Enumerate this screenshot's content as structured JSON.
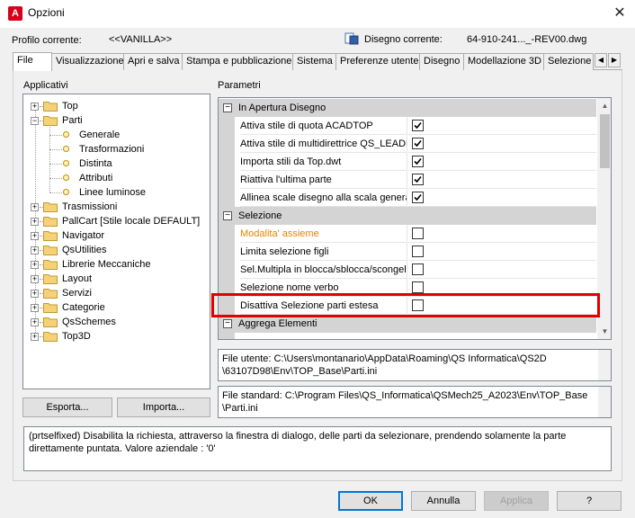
{
  "window": {
    "title": "Opzioni",
    "app_icon_letter": "A",
    "close_glyph": "✕"
  },
  "profile": {
    "current_label": "Profilo corrente:",
    "current_value": "<<VANILLA>>",
    "drawing_label": "Disegno corrente:",
    "drawing_value": "64-910-241..._-REV00.dwg"
  },
  "tabs": [
    {
      "label": "File",
      "active": true
    },
    {
      "label": "Visualizzazione"
    },
    {
      "label": "Apri e salva"
    },
    {
      "label": "Stampa e pubblicazione"
    },
    {
      "label": "Sistema"
    },
    {
      "label": "Preferenze utente"
    },
    {
      "label": "Disegno"
    },
    {
      "label": "Modellazione 3D"
    },
    {
      "label": "Selezione"
    }
  ],
  "tab_arrows": {
    "left": "◀",
    "right": "▶"
  },
  "left_panel": {
    "heading": "Applicativi",
    "tree": [
      {
        "label": "Top",
        "level": 0,
        "type": "folder",
        "expander": "+"
      },
      {
        "label": "Parti",
        "level": 0,
        "type": "folder",
        "expander": "−"
      },
      {
        "label": "Generale",
        "level": 1,
        "type": "leaf"
      },
      {
        "label": "Trasformazioni",
        "level": 1,
        "type": "leaf"
      },
      {
        "label": "Distinta",
        "level": 1,
        "type": "leaf"
      },
      {
        "label": "Attributi",
        "level": 1,
        "type": "leaf"
      },
      {
        "label": "Linee luminose",
        "level": 1,
        "type": "leaf"
      },
      {
        "label": "Trasmissioni",
        "level": 0,
        "type": "folder",
        "expander": "+"
      },
      {
        "label": "PallCart [Stile locale DEFAULT]",
        "level": 0,
        "type": "folder",
        "expander": "+"
      },
      {
        "label": "Navigator",
        "level": 0,
        "type": "folder",
        "expander": "+"
      },
      {
        "label": "QsUtilities",
        "level": 0,
        "type": "folder",
        "expander": "+"
      },
      {
        "label": "Librerie Meccaniche",
        "level": 0,
        "type": "folder",
        "expander": "+"
      },
      {
        "label": "Layout",
        "level": 0,
        "type": "folder",
        "expander": "+"
      },
      {
        "label": "Servizi",
        "level": 0,
        "type": "folder",
        "expander": "+"
      },
      {
        "label": "Categorie",
        "level": 0,
        "type": "folder",
        "expander": "+"
      },
      {
        "label": "QsSchemes",
        "level": 0,
        "type": "folder",
        "expander": "+"
      },
      {
        "label": "Top3D",
        "level": 0,
        "type": "folder",
        "expander": "+"
      }
    ],
    "export_label": "Esporta...",
    "import_label": "Importa..."
  },
  "right_panel": {
    "heading": "Parametri",
    "categories": [
      {
        "label": "In Apertura Disegno",
        "toggle": "−",
        "rows": [
          {
            "label": "Attiva stile di quota ACADTOP",
            "checked": true
          },
          {
            "label": "Attiva stile di multidirettrice QS_LEADE",
            "checked": true
          },
          {
            "label": "Importa stili da Top.dwt",
            "checked": true
          },
          {
            "label": "Riattiva l'ultima parte",
            "checked": true
          },
          {
            "label": "Allinea scale disegno alla scala general",
            "checked": true
          }
        ]
      },
      {
        "label": "Selezione",
        "toggle": "−",
        "rows": [
          {
            "label": "Modalita' assieme",
            "checked": false,
            "highlight": "orange"
          },
          {
            "label": "Limita selezione figli",
            "checked": false
          },
          {
            "label": "Sel.Multipla in blocca/sblocca/scongela",
            "checked": false
          },
          {
            "label": "Selezione nome verbo",
            "checked": false
          },
          {
            "label": "Disattiva Selezione parti estesa",
            "checked": false
          }
        ]
      },
      {
        "label": "Aggrega Elementi",
        "toggle": "−",
        "rows": []
      }
    ],
    "scroll_up": "▲",
    "scroll_down": "▼"
  },
  "files": {
    "user_file": "File utente: C:\\Users\\montanario\\AppData\\Roaming\\QS Informatica\\QS2D\\63107D98\\Env\\TOP_Base\\Parti.ini",
    "user_file_line1": "File utente: C:\\Users\\montanario\\AppData\\Roaming\\QS Informatica\\QS2D",
    "user_file_line2": "\\63107D98\\Env\\TOP_Base\\Parti.ini",
    "standard_file_line1": "File standard: C:\\Program Files\\QS_Informatica\\QSMech25_A2023\\Env\\TOP_Base",
    "standard_file_line2": "\\Parti.ini"
  },
  "description": "(prtselfixed) Disabilita la richiesta, attraverso la finestra di dialogo, delle parti da selezionare, prendendo solamente la parte direttamente puntata. Valore aziendale : '0'",
  "buttons": {
    "ok": "OK",
    "cancel": "Annulla",
    "apply": "Applica",
    "help": "?"
  },
  "colors": {
    "accent": "#0078d7",
    "highlight_border": "#e00000",
    "orange_text": "#e98300",
    "app_icon": "#d6001c"
  }
}
